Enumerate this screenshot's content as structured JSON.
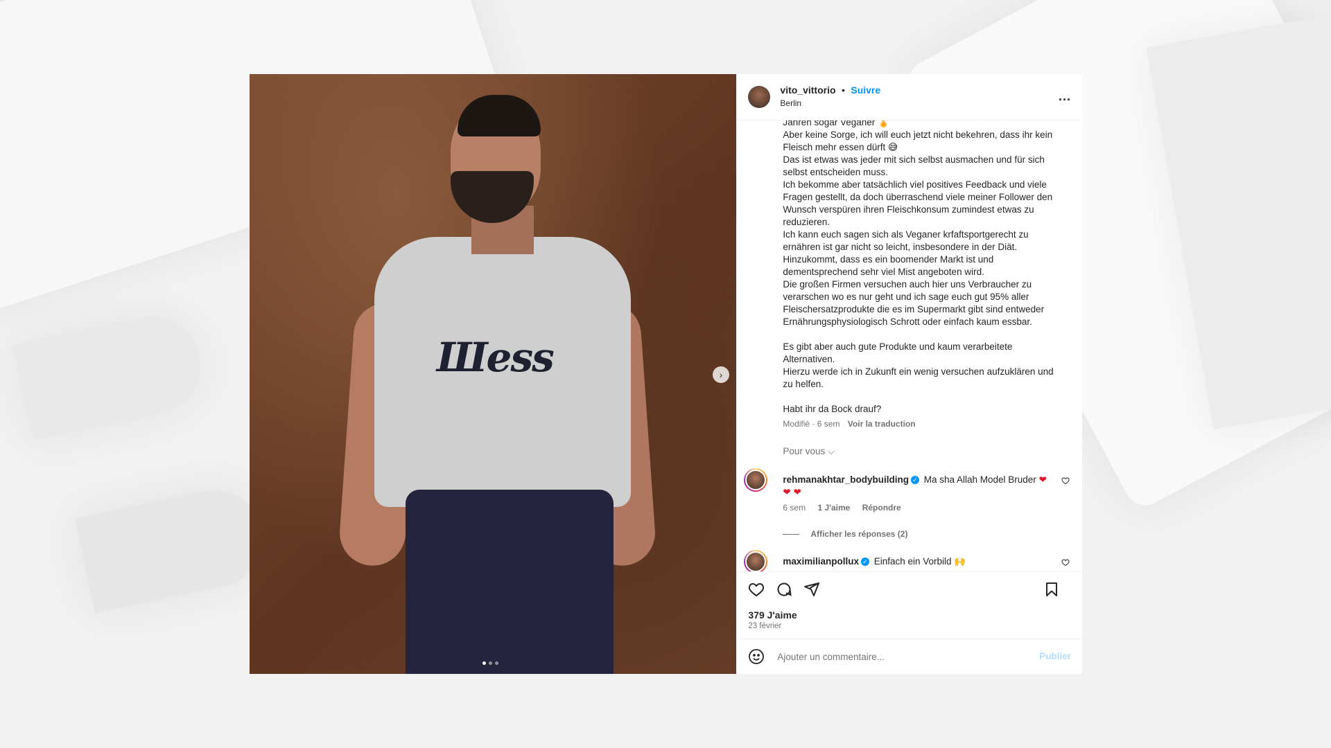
{
  "header": {
    "username": "vito_vittorio",
    "separator": "•",
    "follow_label": "Suivre",
    "location": "Berlin",
    "more_label": "..."
  },
  "media": {
    "shirt_text": "Шess",
    "dots_count": 3,
    "active_dot": 0
  },
  "caption": {
    "lines": [
      "Jahren sogar Veganer 🏅",
      "Aber keine Sorge, ich will euch jetzt nicht bekehren, dass ihr kein Fleisch mehr essen dürft 😅",
      "Das ist etwas was jeder mit sich selbst ausmachen und für sich selbst entscheiden muss.",
      "Ich bekomme aber tatsächlich viel positives Feedback und viele Fragen gestellt, da doch überraschend viele meiner Follower den Wunsch verspüren ihren Fleischkonsum zumindest etwas zu reduzieren.",
      "Ich kann euch sagen sich als Veganer krfaftsportgerecht zu ernähren ist gar nicht so leicht, insbesondere in der Diät.",
      "Hinzukommt, dass es ein boomender Markt ist und dementsprechend sehr viel Mist angeboten wird.",
      "Die großen Firmen versuchen auch hier uns Verbraucher zu verarschen wo es nur geht und ich sage euch gut 95% aller Fleischersatzprodukte die es im Supermarkt gibt sind entweder Ernährungsphysiologisch Schrott oder einfach kaum essbar.",
      "",
      "Es gibt aber auch gute Produkte und kaum verarbeitete Alternativen.",
      "Hierzu werde ich in Zukunft ein wenig versuchen aufzuklären und zu helfen.",
      "",
      "Habt ihr da Bock drauf?"
    ],
    "meta_time": "Modifié · 6 sem",
    "translate_label": "Voir la traduction"
  },
  "filter_label": "Pour vous ⌵",
  "comments": [
    {
      "username": "rehmanakhtar_bodybuilding",
      "text": "Ma sha Allah Model Bruder",
      "hearts": "❤ ❤ ❤",
      "time": "6 sem",
      "likes": "1 J'aime",
      "reply": "Répondre"
    },
    {
      "username": "maximilianpollux",
      "text": "Einfach ein Vorbild 🙌"
    }
  ],
  "view_replies": "Afficher les réponses (2)",
  "likes_count": "379 J'aime",
  "post_date": "23 février",
  "add_comment": {
    "placeholder": "Ajouter un commentaire...",
    "publish_label": "Publier"
  }
}
